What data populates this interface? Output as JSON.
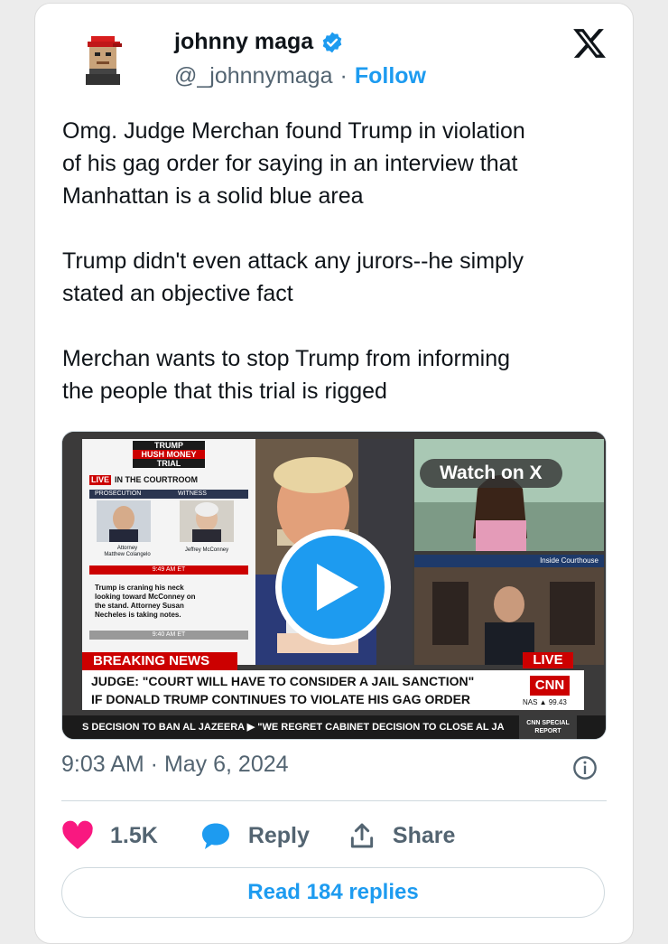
{
  "user": {
    "display_name": "johnny maga",
    "handle": "@_johnnymaga",
    "separator": "·",
    "follow_label": "Follow",
    "verified_color": "#1d9bf0"
  },
  "tweet": {
    "text": "Omg. Judge Merchan found Trump in violation\nof his gag order for saying in an interview that\nManhattan is a solid blue area\n\nTrump didn't even attack any jurors--he simply\nstated an objective fact\n\nMerchan wants to stop Trump from informing\nthe people that this trial is rigged",
    "timestamp": "9:03 AM · May 6, 2024"
  },
  "media": {
    "watch_label": "Watch on X",
    "sidebar_title_1": "TRUMP",
    "sidebar_title_2": "HUSH MONEY",
    "sidebar_title_3": "TRIAL",
    "live_tag": "LIVE",
    "in_courtroom": "IN THE COURTROOM",
    "prosecution": "PROSECUTION",
    "witness": "WITNESS",
    "attorney_label": "Attorney\nMatthew Colangelo",
    "witness_label": "Jeffrey McConney",
    "time_tag": "9:49 AM ET",
    "note": "Trump is craning his neck looking toward McConney on the stand. Attorney Susan Necheles is taking notes.",
    "time_tag_2": "9:40 AM ET",
    "inside_courthouse": "Inside Courthouse",
    "breaking": "BREAKING NEWS",
    "live_right": "LIVE",
    "headline_1": "JUDGE: \"COURT WILL HAVE TO CONSIDER A JAIL SANCTION\"",
    "headline_2": "IF DONALD TRUMP CONTINUES TO VIOLATE HIS GAG ORDER",
    "network": "CNN",
    "nas": "NAS ▲ 99.43",
    "ticker": "S DECISION TO BAN AL JAZEERA  ▶  \"WE REGRET CABINET DECISION TO CLOSE AL JA",
    "special": "CNN SPECIAL REPORT"
  },
  "actions": {
    "likes": "1.5K",
    "reply_label": "Reply",
    "share_label": "Share",
    "like_color": "#f91880",
    "reply_color": "#1d9bf0"
  },
  "read_replies_label": "Read 184 replies"
}
